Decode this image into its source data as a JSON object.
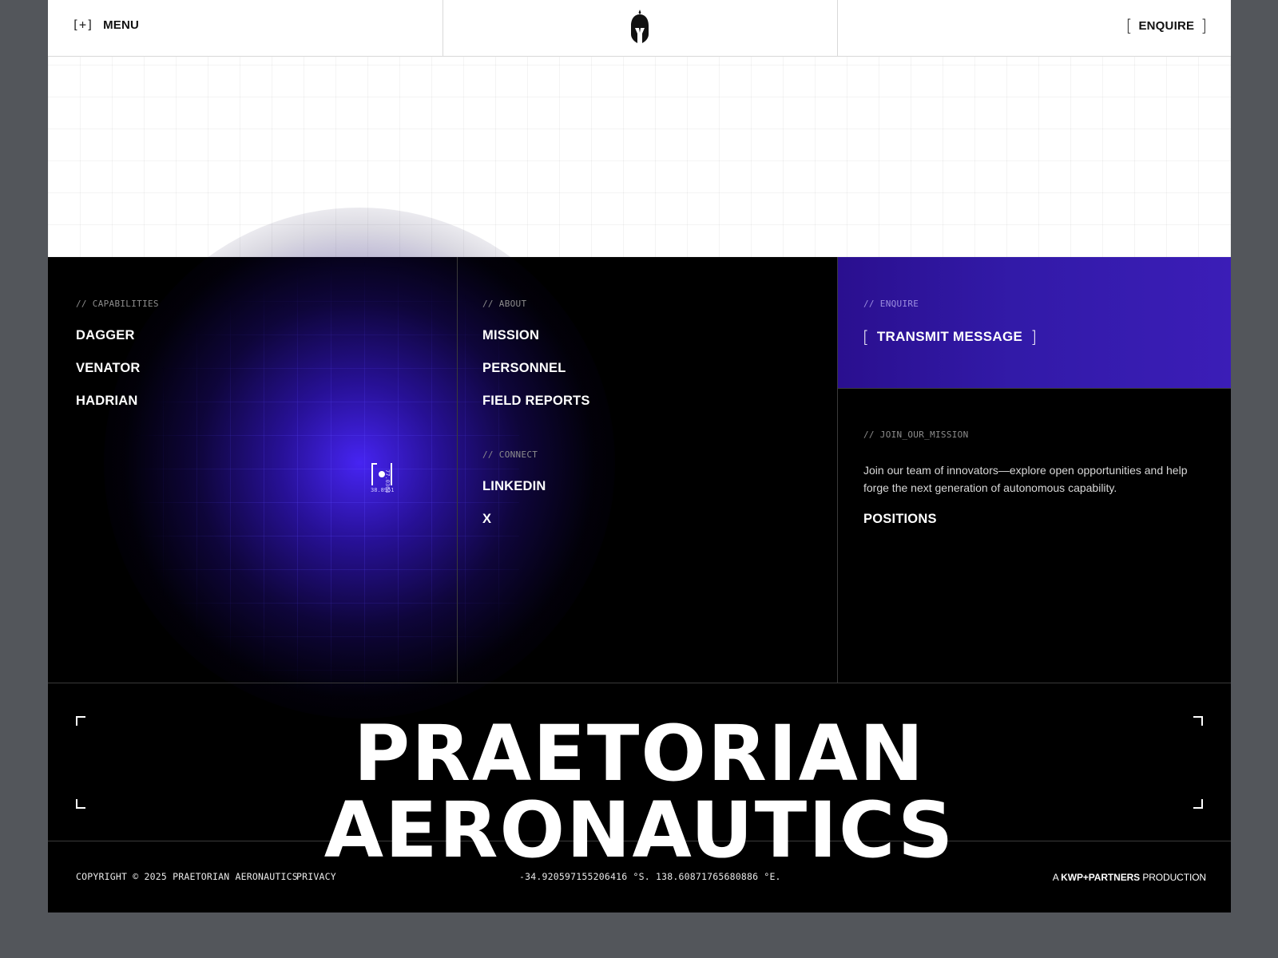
{
  "header": {
    "menu_icon": "[+]",
    "menu_label": "MENU",
    "logo_icon": "spartan-helmet-icon",
    "enquire_open": "[",
    "enquire_label": "ENQUIRE",
    "enquire_close": "]"
  },
  "capabilities": {
    "label": "// CAPABILITIES",
    "items": [
      "DAGGER",
      "VENATOR",
      "HADRIAN"
    ]
  },
  "about": {
    "label": "// ABOUT",
    "items": [
      "MISSION",
      "PERSONNEL",
      "FIELD REPORTS"
    ]
  },
  "connect": {
    "label": "// CONNECT",
    "items": [
      "LINKEDIN",
      "X"
    ]
  },
  "enquire_panel": {
    "label": "// ENQUIRE",
    "open": "[",
    "button_label": "TRANSMIT MESSAGE",
    "close": "]"
  },
  "join": {
    "label": "// JOIN_OUR_MISSION",
    "text": "Join our team of innovators—explore open opportunities and help forge the next generation of autonomous capability.",
    "link": "POSITIONS"
  },
  "target_marker": {
    "lat": "38.8951",
    "lon": "77.0364"
  },
  "wordmark": "PRAETORIAN AERONAUTICS",
  "footer": {
    "copyright": "COPYRIGHT © 2025 PRAETORIAN AERONAUTICS",
    "privacy": "PRIVACY",
    "coordinates": "-34.920597155206416 °S. 138.60871765680886 °E.",
    "credit_prefix": "A ",
    "credit_brand": "KWP+PARTNERS",
    "credit_suffix": " PRODUCTION"
  },
  "colors": {
    "accent_purple": "#3b1db7",
    "background": "#000000",
    "outer_background": "#53565b"
  }
}
